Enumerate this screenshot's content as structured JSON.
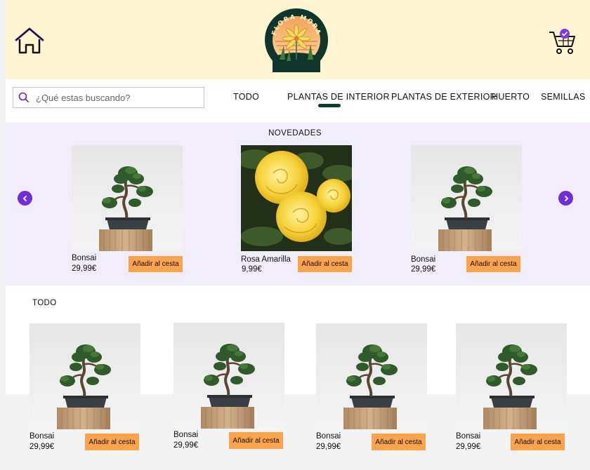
{
  "header": {
    "home_icon": "home-icon",
    "logo_text": "FLORA MORA",
    "logo_icon": "flower-logo",
    "cart_icon": "cart-icon",
    "cart_badge_icon": "check-icon"
  },
  "search": {
    "placeholder": "¿Qué estas buscando?",
    "icon": "search-icon"
  },
  "nav": {
    "items": [
      "TODO",
      "PLANTAS DE INTERIOR",
      "PLANTAS DE EXTERIOR",
      "HUERTO",
      "SEMILLAS"
    ],
    "active_index": 1
  },
  "novedades": {
    "title": "NOVEDADES",
    "prev_icon": "chevron-left-icon",
    "next_icon": "chevron-right-icon",
    "products": [
      {
        "name": "Bonsai",
        "price": "29,99€",
        "button": "Añadir al cesta",
        "image": "bonsai"
      },
      {
        "name": "Rosa Amarilla",
        "price": "9,99€",
        "button": "Añadir al cesta",
        "image": "yellow-rose"
      },
      {
        "name": "Bonsai",
        "price": "29,99€",
        "button": "Añadir al cesta",
        "image": "bonsai"
      }
    ]
  },
  "todo": {
    "title": "TODO",
    "products": [
      {
        "name": "Bonsai",
        "price": "29,99€",
        "button": "Añadir al cesta",
        "image": "bonsai"
      },
      {
        "name": "Bonsai",
        "price": "29,99€",
        "button": "Añadir al cesta",
        "image": "bonsai"
      },
      {
        "name": "Bonsai",
        "price": "29,99€",
        "button": "Añadir al cesta",
        "image": "bonsai"
      },
      {
        "name": "Bonsai",
        "price": "29,99€",
        "button": "Añadir al cesta",
        "image": "bonsai"
      }
    ]
  },
  "colors": {
    "header_bg": "#fff6d1",
    "band_bg": "#f2edfb",
    "accent_purple": "#6f2ed8",
    "button_orange": "#fca34d",
    "underline_green": "#0e3b2c"
  }
}
